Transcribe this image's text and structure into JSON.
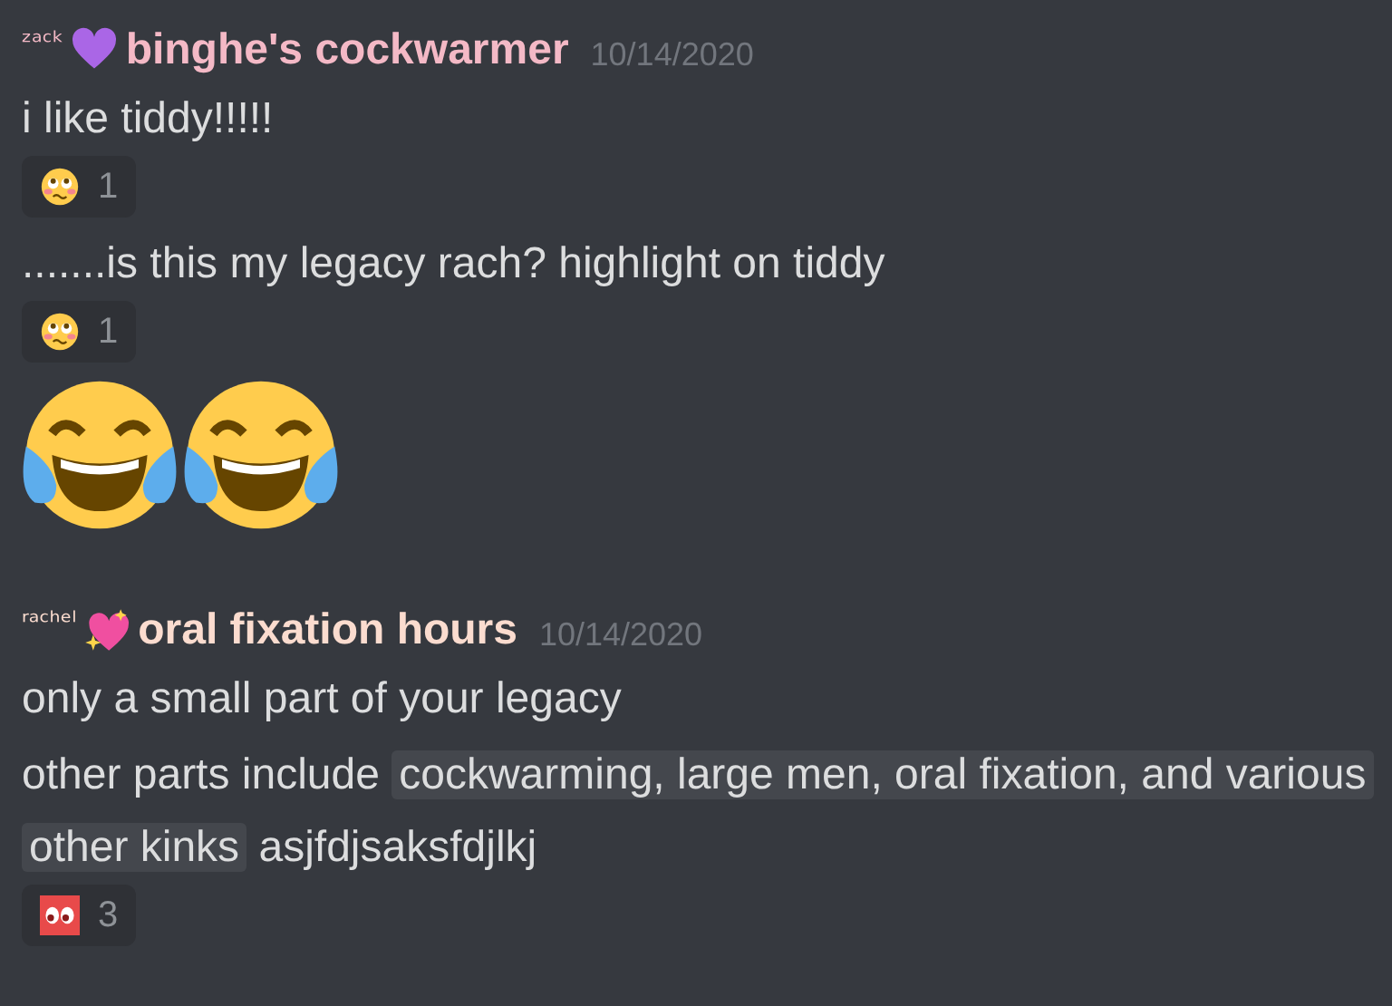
{
  "groups": [
    {
      "prefix": "ᶻᵃᶜᵏ",
      "badge": {
        "kind": "purple-heart"
      },
      "name": "binghe's cockwarmer",
      "color": "#f4b9c6",
      "timestamp": "10/14/2020",
      "messages": [
        {
          "kind": "text",
          "parts": [
            {
              "kind": "plain",
              "text": "i like tiddy!!!!!"
            }
          ],
          "reactions": [
            {
              "kind": "pleading",
              "count": "1"
            }
          ]
        },
        {
          "kind": "text",
          "parts": [
            {
              "kind": "plain",
              "text": ".......is this my legacy rach? highlight on tiddy"
            }
          ],
          "reactions": [
            {
              "kind": "pleading",
              "count": "1"
            }
          ]
        },
        {
          "kind": "jumbo",
          "emojis": [
            {
              "kind": "tears-of-joy"
            },
            {
              "kind": "tears-of-joy"
            }
          ]
        }
      ]
    },
    {
      "prefix": "ʳᵃᶜʰᵉˡ",
      "badge": {
        "kind": "sparkling-heart"
      },
      "name": "oral fixation hours",
      "color": "#fbdccf",
      "timestamp": "10/14/2020",
      "messages": [
        {
          "kind": "text",
          "parts": [
            {
              "kind": "plain",
              "text": "only a small part of your legacy"
            }
          ]
        },
        {
          "kind": "text",
          "parts": [
            {
              "kind": "plain",
              "text": "other parts include "
            },
            {
              "kind": "spoiler",
              "text": "cockwarming, large men, oral fixation, and various other kinks"
            },
            {
              "kind": "plain",
              "text": " asjfdjsaksfdjlkj"
            }
          ],
          "reactions": [
            {
              "kind": "eyes",
              "count": "3"
            }
          ]
        }
      ]
    }
  ]
}
